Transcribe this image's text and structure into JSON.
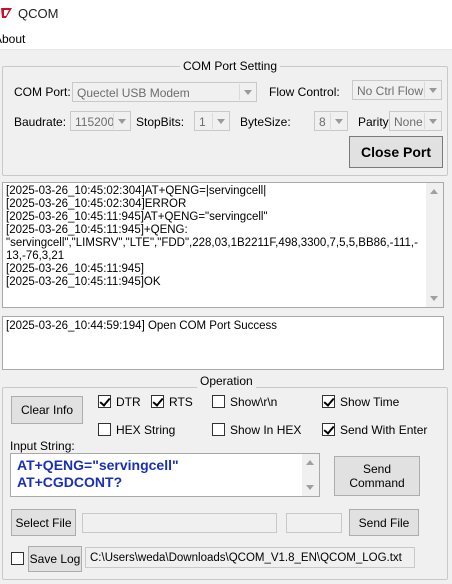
{
  "window": {
    "title": "QCOM"
  },
  "menu": {
    "items": [
      {
        "label": "About"
      }
    ]
  },
  "com_port_setting": {
    "group_title": "COM Port Setting",
    "com_port": {
      "label": "COM Port:",
      "value": "Quectel USB Modem"
    },
    "flow_control": {
      "label": "Flow Control:",
      "value": "No Ctrl Flow"
    },
    "baudrate": {
      "label": "Baudrate:",
      "value": "115200"
    },
    "stop_bits": {
      "label": "StopBits:",
      "value": "1"
    },
    "byte_size": {
      "label": "ByteSize:",
      "value": "8"
    },
    "parity": {
      "label": "Parity:",
      "value": "None"
    },
    "close_port_label": "Close Port"
  },
  "log": {
    "lines": [
      "[2025-03-26_10:45:02:304]AT+QENG=|servingcell|",
      "[2025-03-26_10:45:02:304]ERROR",
      "[2025-03-26_10:45:11:945]AT+QENG=\"servingcell\"",
      "[2025-03-26_10:45:11:945]+QENG:",
      "\"servingcell\",\"LIMSRV\",\"LTE\",\"FDD\",228,03,1B2211F,498,3300,7,5,5,BB86,-111,-",
      "13,-76,3,21",
      "[2025-03-26_10:45:11:945]",
      "[2025-03-26_10:45:11:945]OK"
    ]
  },
  "status": {
    "message": "[2025-03-26_10:44:59:194] Open COM Port Success"
  },
  "operation": {
    "group_title": "Operation",
    "clear_info_label": "Clear Info",
    "checkboxes": [
      {
        "label": "DTR",
        "checked": true
      },
      {
        "label": "RTS",
        "checked": true
      },
      {
        "label": "Show\\r\\n",
        "checked": false
      },
      {
        "label": "Show Time",
        "checked": true
      },
      {
        "label": "HEX String",
        "checked": false
      },
      {
        "label": "Show In HEX",
        "checked": false
      },
      {
        "label": "Send With Enter",
        "checked": true
      }
    ],
    "input_string_label": "Input String:",
    "input_string_value": "AT+QENG=\"servingcell\"\nAT+CGDCONT?",
    "send_command_label": "Send Command",
    "select_file_label": "Select File",
    "send_file_label": "Send File",
    "save_log": {
      "label": "Save Log",
      "checked": false
    },
    "log_path": "C:\\Users\\weda\\Downloads\\QCOM_V1.8_EN\\QCOM_LOG.txt"
  },
  "colors": {
    "input_text": "#1a2fb8",
    "logo_red": "#c8102e"
  }
}
